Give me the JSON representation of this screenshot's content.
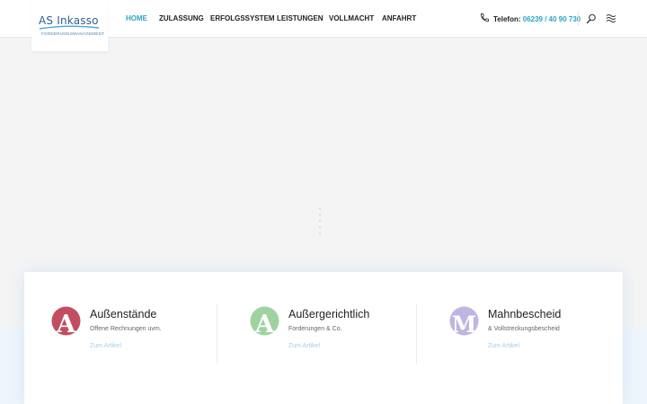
{
  "logo": {
    "title": "AS Inkasso",
    "subtitle": "FORDERUNGSMANAGEMENT"
  },
  "nav": {
    "items": [
      {
        "label": "HOME",
        "active": true
      },
      {
        "label": "ZULASSUNG",
        "active": false
      },
      {
        "label": "ERFOLGSSYSTEM",
        "active": false
      },
      {
        "label": "LEISTUNGEN",
        "active": false
      },
      {
        "label": "VOLLMACHT",
        "active": false
      },
      {
        "label": "ANFAHRT",
        "active": false
      }
    ]
  },
  "contact": {
    "phone_label": "Telefon:",
    "phone_number": "06239 / 40 90 730"
  },
  "features": [
    {
      "letter": "A",
      "color": "#c24d61",
      "title": "Außenstände",
      "description": "Offene Rechnungen uvm.",
      "link": "Zum Artikel"
    },
    {
      "letter": "A",
      "color": "#9ed3a0",
      "title": "Außergerichtlich",
      "description": "Forderungen & Co.",
      "link": "Zum Artikel"
    },
    {
      "letter": "M",
      "color": "#c0b4e0",
      "title": "Mahnbescheid",
      "description": "& Vollstreckungsbescheid",
      "link": "Zum Artikel"
    }
  ],
  "colors": {
    "accent": "#2fa3c6",
    "text": "#222222",
    "link": "#a9cde7",
    "logo_blue": "#2f5f8f"
  },
  "icons": {
    "phone": "phone-icon",
    "search": "search-icon",
    "menu": "wave-menu-icon"
  }
}
